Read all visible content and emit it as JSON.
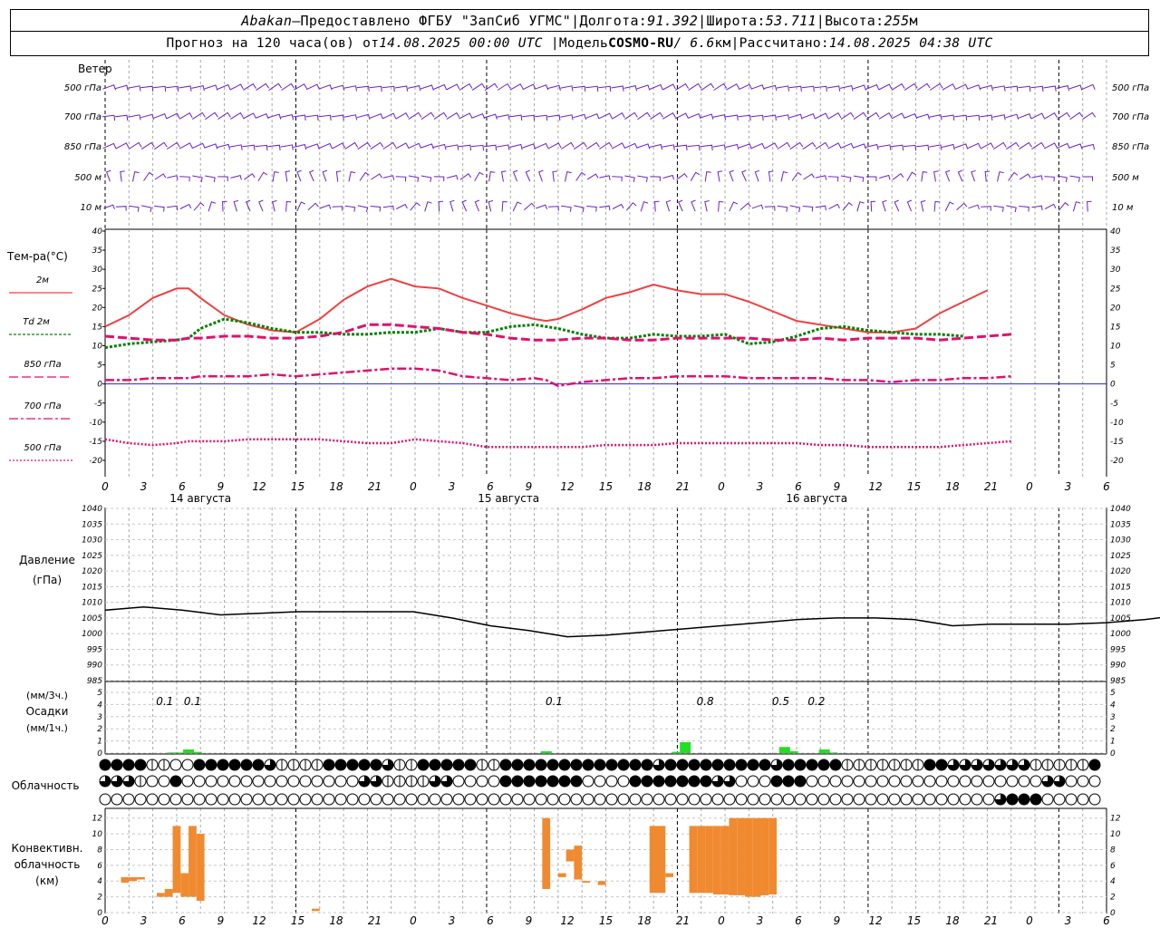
{
  "header": {
    "station": "Abakan",
    "dash": " — ",
    "provider": "Предоставлено ФГБУ \"ЗапСиб УГМС\"",
    "sep": " | ",
    "lon_label": "Долгота: ",
    "lon": "91.392",
    "lat_label": "Широта: ",
    "lat": "53.711",
    "alt_label": "Высота: ",
    "alt": "255",
    "alt_unit": "м",
    "forecast_pre": "Прогноз на 120 часа(ов) от ",
    "forecast_time": "14.08.2025 00:00 UTC",
    "model_label": "Модель ",
    "model": "COSMO-RU",
    "model_res": " / 6.6",
    "model_res_unit": "км",
    "calc_label": "Рассчитано: ",
    "calc_time": "14.08.2025 04:38 UTC"
  },
  "panel_labels": {
    "wind": "Ветер",
    "wind_levels": [
      "500 гПа",
      "700 гПа",
      "850 гПа",
      "500 м",
      "10  м"
    ],
    "temp": "Тем-ра(°C)",
    "temp_legend": [
      "2м",
      "Td  2м",
      "850 гПа",
      "700 гПа",
      "500 гПа"
    ],
    "pressure": [
      "Давление",
      "(гПа)"
    ],
    "precip": [
      "(мм/3ч.)",
      "Осадки",
      "(мм/1ч.)"
    ],
    "cloud": "Облачность",
    "conv": [
      "Конвективн.",
      "облачность",
      "(км)"
    ]
  },
  "time_axis": {
    "hour_labels": [
      "0",
      "3",
      "6",
      "9",
      "12",
      "15",
      "18",
      "21",
      "0",
      "3",
      "6",
      "9",
      "12",
      "15",
      "18",
      "21",
      "0",
      "3",
      "6",
      "9",
      "12",
      "15",
      "18",
      "21",
      "0",
      "3",
      "6"
    ],
    "day_labels": [
      "14 августа",
      "15 августа",
      "16 августа"
    ]
  },
  "colors": {
    "t2m": "#f04040",
    "td2m": "#008000",
    "t850": "#e0106e",
    "t700": "#e0106e",
    "t500": "#e0106e",
    "wind": "#6a1fcf",
    "precip": "#20e020",
    "conv": "#f08a30",
    "zero_line": "#2020ff"
  },
  "chart_data": [
    {
      "type": "line",
      "name": "temperature",
      "x_hours": [
        0,
        3,
        6,
        9,
        10.5,
        12,
        15,
        18,
        21,
        24,
        27,
        30,
        33,
        36,
        39,
        42,
        45,
        48,
        51,
        54,
        55.5,
        57,
        60,
        63,
        66,
        69,
        72,
        75,
        78,
        81,
        84,
        87,
        90,
        93,
        96,
        99,
        102,
        105,
        108,
        111,
        114,
        117,
        120,
        123,
        126
      ],
      "series": [
        {
          "name": "2м",
          "values": [
            15,
            18,
            22.5,
            25,
            25,
            22.5,
            18,
            15.5,
            14,
            13.5,
            17,
            22,
            25.5,
            27.5,
            25.5,
            25,
            22.5,
            20.5,
            18.5,
            17,
            16.5,
            17,
            19.5,
            22.5,
            24,
            26,
            24.5,
            23.5,
            23.5,
            21.5,
            19,
            16.5,
            15.5,
            14.5,
            13.5,
            13.5,
            14.5,
            18.5,
            21.5,
            24.5,
            null,
            null,
            null,
            null,
            null
          ]
        },
        {
          "name": "Td  2м",
          "values": [
            9.5,
            10.5,
            11,
            11.5,
            12,
            14.5,
            17,
            16,
            14.5,
            13.5,
            13.5,
            13,
            13,
            13.5,
            13.5,
            14.5,
            13.5,
            13.5,
            15,
            15.5,
            15,
            14.5,
            13,
            12,
            12,
            13,
            12.5,
            12.5,
            13,
            10.5,
            11,
            12.5,
            14.5,
            15,
            14,
            13.5,
            13,
            13,
            12.5,
            null,
            null,
            null,
            null,
            null,
            null
          ]
        },
        {
          "name": "850 гПа",
          "values": [
            12.5,
            12,
            11.5,
            11.5,
            12,
            12,
            12.5,
            12.5,
            12,
            12,
            12.5,
            13.5,
            15.5,
            15.5,
            15,
            14.5,
            13.5,
            13,
            12,
            11.5,
            11.5,
            11.5,
            12,
            12,
            11.5,
            11.5,
            12,
            12,
            12,
            12,
            11.5,
            11.5,
            12,
            11.5,
            12,
            12,
            12,
            11.5,
            12,
            12.5,
            13,
            null,
            null,
            null,
            null
          ]
        },
        {
          "name": "700 гПа",
          "values": [
            1,
            1,
            1.5,
            1.5,
            1.5,
            2,
            2,
            2,
            2.5,
            2,
            2.5,
            3,
            3.5,
            4,
            4,
            3.5,
            2,
            1.5,
            1,
            1.5,
            1,
            -0.5,
            0.5,
            1,
            1.5,
            1.5,
            2,
            2,
            2,
            1.5,
            1.5,
            1.5,
            1.5,
            1,
            1,
            0.5,
            1,
            1,
            1.5,
            1.5,
            2,
            null,
            null,
            null,
            null
          ]
        },
        {
          "name": "500 гПа",
          "values": [
            -14.5,
            -15.5,
            -16,
            -15.5,
            -15,
            -15,
            -15,
            -14.5,
            -14.5,
            -14.5,
            -14.5,
            -15,
            -15.5,
            -15.5,
            -14.5,
            -15,
            -15.5,
            -16.5,
            -16.5,
            -16.5,
            -16.5,
            -16.5,
            -16.5,
            -16,
            -16,
            -16,
            -15.5,
            -15.5,
            -15.5,
            -15.5,
            -15.5,
            -15.5,
            -16,
            -16,
            -16.5,
            -16.5,
            -16.5,
            -16.5,
            -16,
            -15.5,
            -15,
            null,
            null,
            null,
            null
          ]
        }
      ],
      "ylim": [
        -20,
        40
      ],
      "yticks": [
        "-20",
        "-15",
        "-10",
        "-5",
        "0",
        "5",
        "10",
        "15",
        "20",
        "25",
        "30",
        "35",
        "40"
      ]
    },
    {
      "type": "line",
      "name": "pressure",
      "x_hours": [
        0,
        3,
        6,
        9,
        12,
        15,
        18,
        21,
        24,
        27,
        30,
        33,
        36,
        39,
        42,
        45,
        48,
        51,
        54,
        57,
        60,
        63,
        66,
        69,
        72,
        75,
        78,
        81,
        84,
        87,
        90,
        93,
        96,
        99,
        102,
        105,
        108,
        111,
        114,
        117,
        120,
        123,
        126
      ],
      "series": [
        {
          "name": "p",
          "values": [
            1007.5,
            1008.5,
            1007.5,
            1006,
            1006.5,
            1007,
            1007,
            1007,
            1007,
            1005,
            1002.5,
            1001,
            999,
            999.5,
            1000.5,
            1001.5,
            1002.5,
            1003.5,
            1004.5,
            1005,
            1005,
            1004.5,
            1002.5,
            1003,
            1003,
            1003,
            1003.5,
            1004.5,
            1006,
            1006.5,
            1006.5,
            1007,
            1007,
            1007,
            1006,
            1004,
            null,
            null,
            null,
            null,
            null,
            null,
            null
          ]
        }
      ],
      "ylim": [
        985,
        1040
      ],
      "yticks": [
        "985",
        "990",
        "995",
        "1000",
        "1005",
        "1010",
        "1015",
        "1020",
        "1025",
        "1030",
        "1035",
        "1040"
      ]
    },
    {
      "type": "bar",
      "name": "precipitation",
      "x_hours": [
        8.5,
        9.5,
        10.5,
        11.5,
        55.5,
        72,
        73,
        85.5,
        86.5,
        90.5,
        91.5
      ],
      "values": [
        0.05,
        0.05,
        0.3,
        0.1,
        0.15,
        0.1,
        0.9,
        0.5,
        0.15,
        0.3,
        0.05
      ],
      "annotations": [
        {
          "x_hour": 7.5,
          "text": "0.1"
        },
        {
          "x_hour": 11,
          "text": "0.1"
        },
        {
          "x_hour": 56.5,
          "text": "0.1"
        },
        {
          "x_hour": 75.5,
          "text": "0.8"
        },
        {
          "x_hour": 85,
          "text": "0.5"
        },
        {
          "x_hour": 89.5,
          "text": "0.2"
        }
      ],
      "ylim": [
        0,
        5
      ],
      "yticks": [
        "0",
        "1",
        "2",
        "3",
        "4",
        "5"
      ]
    },
    {
      "type": "bar",
      "name": "convective_clouds",
      "bars_hours": [
        [
          2,
          3,
          4.5
        ],
        [
          3,
          4,
          4.5
        ],
        [
          4,
          5,
          4.5
        ],
        [
          6.5,
          7.5,
          2.5
        ],
        [
          7.5,
          8.5,
          3
        ],
        [
          8.5,
          9.5,
          11
        ],
        [
          9.5,
          10.5,
          5
        ],
        [
          10.5,
          11.5,
          11
        ],
        [
          11.5,
          12.5,
          10
        ],
        [
          26,
          27,
          0.5
        ],
        [
          55,
          56,
          12
        ],
        [
          57,
          58,
          5
        ],
        [
          58,
          59,
          8
        ],
        [
          59,
          60,
          8.5
        ],
        [
          60,
          61,
          4
        ],
        [
          62,
          63,
          4
        ],
        [
          68.5,
          69.5,
          11
        ],
        [
          69.5,
          70.5,
          11
        ],
        [
          70.5,
          71.5,
          5
        ],
        [
          73.5,
          74.5,
          11
        ],
        [
          74.5,
          75.5,
          11
        ],
        [
          75.5,
          76.5,
          11
        ],
        [
          76.5,
          77.5,
          11
        ],
        [
          77.5,
          78.5,
          11
        ],
        [
          78.5,
          79.5,
          12
        ],
        [
          79.5,
          80.5,
          12
        ],
        [
          80.5,
          81.5,
          12
        ],
        [
          81.5,
          82.5,
          12
        ],
        [
          82.5,
          83.5,
          12
        ],
        [
          83.5,
          84.5,
          12
        ]
      ],
      "bars_base": [
        3.8,
        4,
        4.2,
        2,
        2,
        2.5,
        2,
        2,
        1.5,
        0.2,
        3,
        4.5,
        6.5,
        4.2,
        3.8,
        3.5,
        2.5,
        2.5,
        4.5,
        2.5,
        2.5,
        2.5,
        2.3,
        2.3,
        2.2,
        2.2,
        2,
        2,
        2.2,
        2.3
      ],
      "ylim": [
        0,
        13
      ],
      "yticks": [
        "0",
        "2",
        "4",
        "6",
        "8",
        "10",
        "12"
      ]
    },
    {
      "type": "table",
      "name": "cloud_cover",
      "rows": [
        [
          4,
          4,
          4,
          4,
          2,
          2,
          0,
          0,
          4,
          4,
          4,
          4,
          4,
          4,
          3,
          2,
          2,
          2,
          2,
          4,
          4,
          4,
          4,
          4,
          3,
          2,
          2,
          4,
          4,
          4,
          4,
          4,
          2,
          2,
          4,
          4,
          4,
          4,
          4,
          4,
          4,
          4,
          4,
          4,
          4,
          4,
          4,
          3,
          4,
          4,
          4,
          4,
          4,
          4,
          4,
          4,
          4,
          3,
          4,
          4,
          4,
          4,
          4,
          2,
          2,
          2,
          2,
          2,
          2,
          2,
          4,
          4,
          3,
          3,
          3,
          3,
          3,
          3,
          3,
          2,
          2,
          2,
          2,
          2,
          4
        ],
        [
          3,
          3,
          3,
          2,
          0,
          0,
          4,
          0,
          0,
          0,
          0,
          0,
          0,
          0,
          0,
          0,
          0,
          0,
          0,
          0,
          0,
          0,
          3,
          3,
          2,
          2,
          2,
          2,
          3,
          3,
          0,
          0,
          0,
          0,
          4,
          4,
          4,
          4,
          4,
          4,
          4,
          0,
          0,
          0,
          0,
          4,
          4,
          4,
          4,
          4,
          4,
          4,
          3,
          3,
          0,
          0,
          0,
          4,
          4,
          4,
          0,
          0,
          0,
          0,
          0,
          0,
          0,
          0,
          0,
          0,
          0,
          0,
          0,
          0,
          0,
          0,
          0,
          0,
          0,
          0,
          3,
          3,
          0,
          0,
          0
        ],
        [
          0,
          0,
          0,
          0,
          0,
          0,
          0,
          0,
          0,
          0,
          0,
          0,
          0,
          0,
          0,
          0,
          0,
          0,
          0,
          0,
          0,
          0,
          0,
          0,
          0,
          0,
          0,
          0,
          0,
          0,
          0,
          0,
          0,
          0,
          0,
          0,
          0,
          0,
          0,
          0,
          0,
          0,
          0,
          0,
          0,
          0,
          0,
          0,
          0,
          0,
          0,
          0,
          0,
          0,
          0,
          0,
          0,
          0,
          0,
          0,
          0,
          0,
          0,
          0,
          0,
          0,
          0,
          0,
          0,
          0,
          0,
          0,
          0,
          0,
          0,
          0,
          3,
          4,
          4,
          4,
          0,
          0,
          0,
          0,
          0
        ]
      ]
    }
  ]
}
